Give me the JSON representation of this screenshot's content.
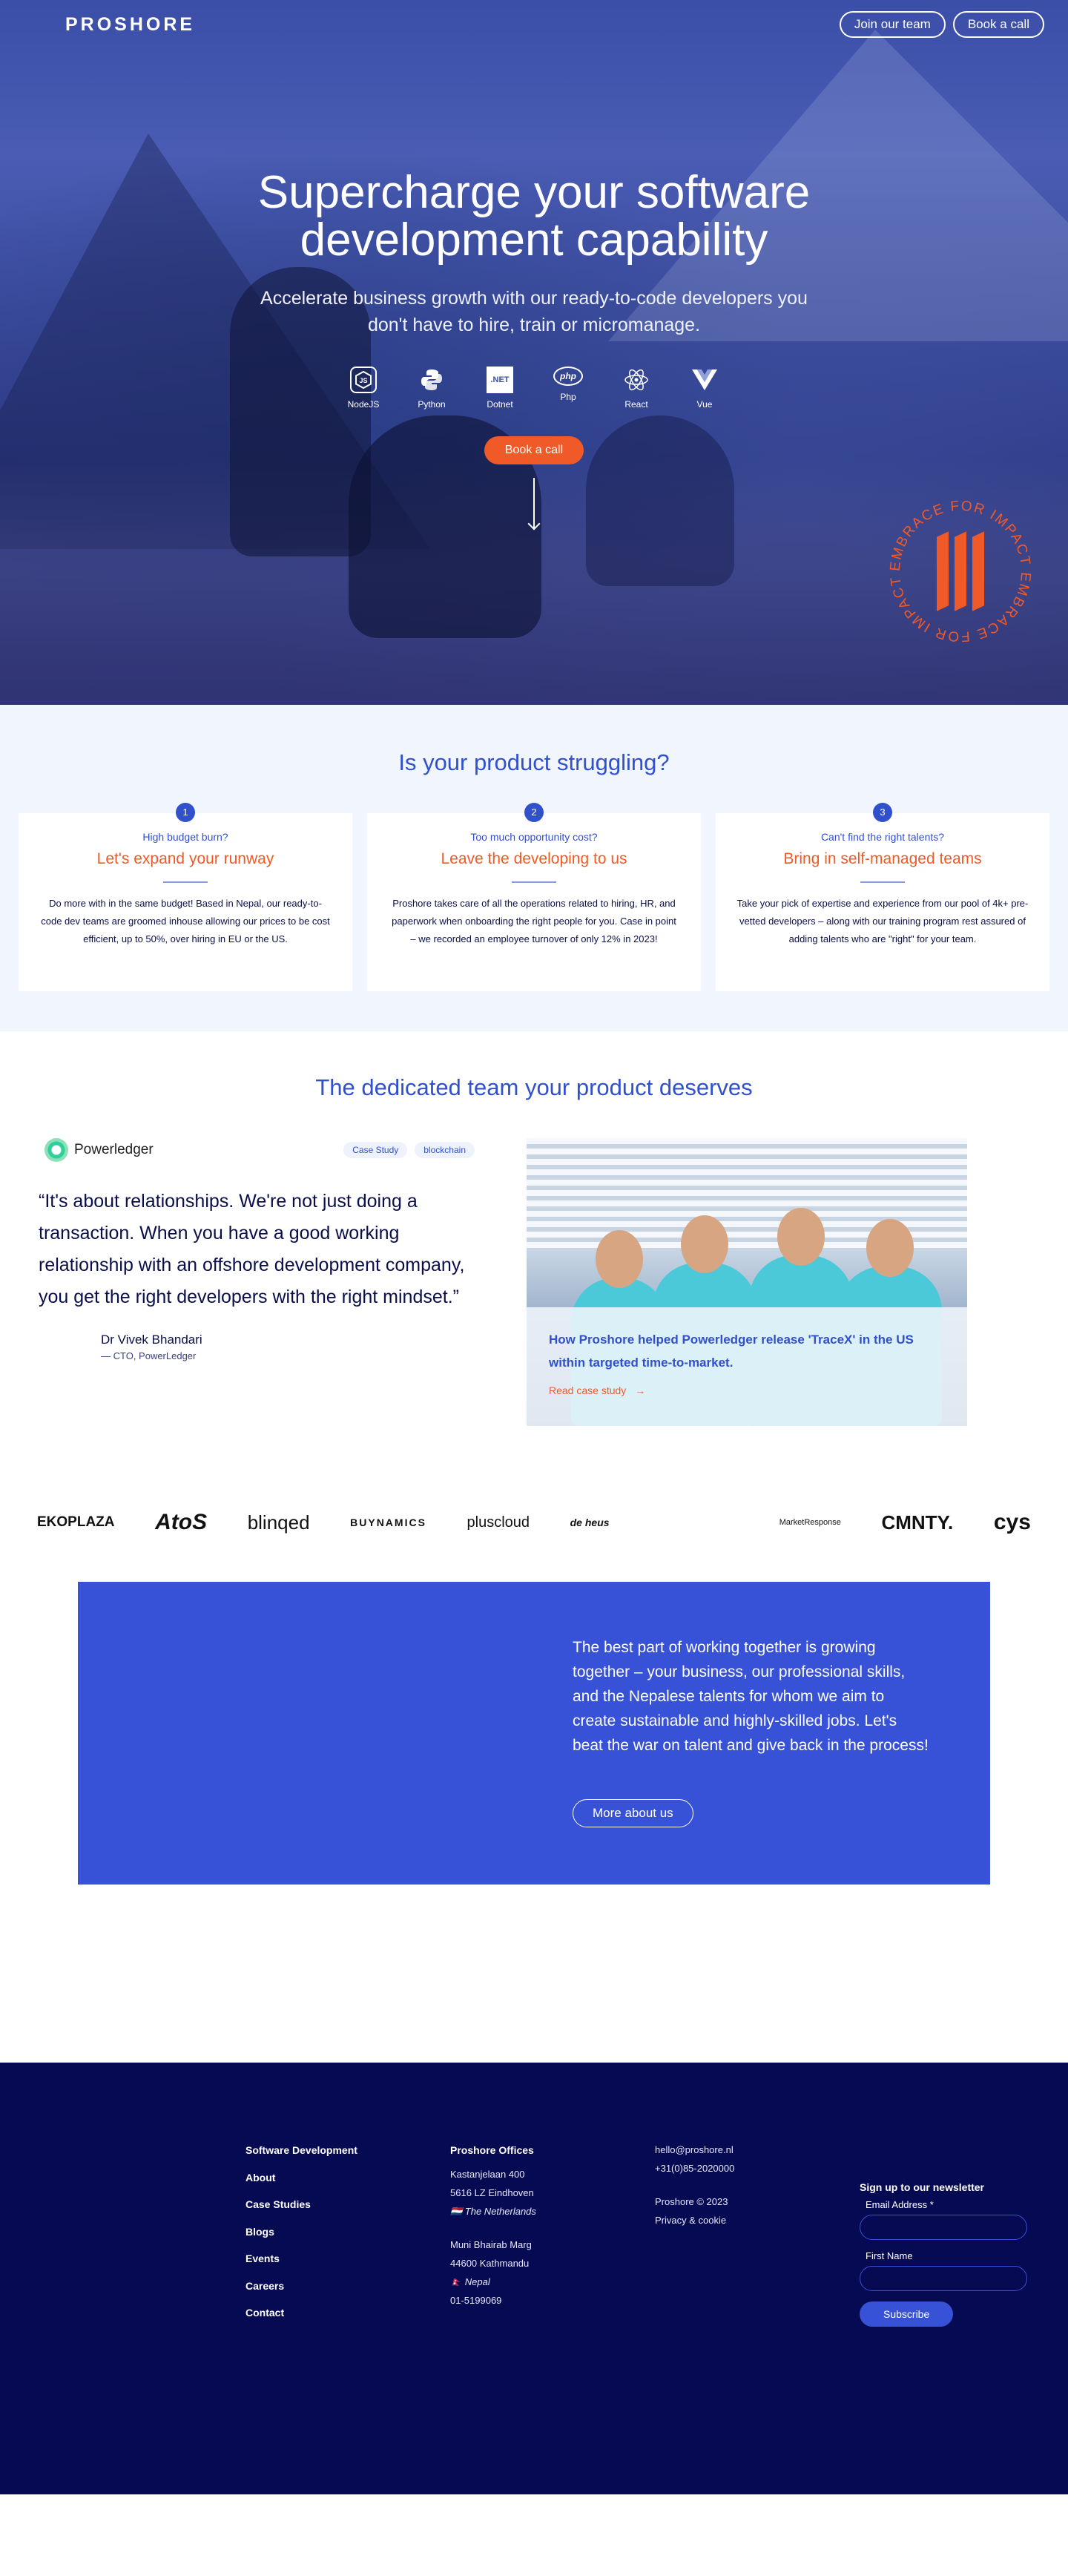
{
  "header": {
    "logo": "PROSHORE",
    "join_label": "Join our team",
    "book_label": "Book a call"
  },
  "hero": {
    "title": "Supercharge your software development capability",
    "subtitle": "Accelerate business growth with our ready-to-code developers you don't have to hire, train or micromanage.",
    "technologies": [
      {
        "label": "NodeJS",
        "icon": "nodejs-icon"
      },
      {
        "label": "Python",
        "icon": "python-icon"
      },
      {
        "label": "Dotnet",
        "icon": "dotnet-icon"
      },
      {
        "label": "Php",
        "icon": "php-icon"
      },
      {
        "label": "React",
        "icon": "react-icon"
      },
      {
        "label": "Vue",
        "icon": "vue-icon"
      }
    ],
    "dotnet_text": ".NET",
    "php_text": "php",
    "cta_label": "Book a call",
    "badge_text": "EMBRACE FOR IMPACT EMBRACE FOR IMPACT"
  },
  "struggle": {
    "title": "Is your product struggling?",
    "cards": [
      {
        "num": "1",
        "eyebrow": "High budget burn?",
        "title": "Let's expand your runway",
        "text": "Do more with in the same budget! Based in Nepal, our ready-to-code dev teams are groomed inhouse allowing our prices to be cost efficient, up to 50%, over hiring in EU or the US."
      },
      {
        "num": "2",
        "eyebrow": "Too much opportunity cost?",
        "title": "Leave the developing to us",
        "text": "Proshore takes care of all the operations related to hiring, HR, and paperwork when onboarding the right people for you. Case in point – we recorded an employee turnover of only 12% in 2023!"
      },
      {
        "num": "3",
        "eyebrow": "Can't find the right talents?",
        "title": "Bring in self-managed teams",
        "text": "Take your pick of expertise and experience from our pool of 4k+ pre-vetted developers – along with our training program rest assured of adding talents who are \"right\" for your team."
      }
    ]
  },
  "team": {
    "title": "The dedicated team your product deserves",
    "client_name": "Powerledger",
    "tags": [
      "Case Study",
      "blockchain"
    ],
    "quote": "“It's about relationships. We're not just doing a transaction. When you have a good working relationship with an offshore development company, you get the right developers with the right mindset.”",
    "author_name": "Dr Vivek Bhandari",
    "author_role": "— CTO, PowerLedger",
    "case_title": "How Proshore helped Powerledger release 'TraceX' in the US within targeted time-to-market.",
    "case_link": "Read case study",
    "case_arrow": "→"
  },
  "clients": [
    "EKOPLAZA",
    "AtoS",
    "blinqed",
    "BUYNAMICS",
    "pluscloud",
    "de heus",
    "MarketResponse",
    "CMNTY.",
    "cys"
  ],
  "about": {
    "text": "The best part of working together is growing together – your business, our professional skills, and the Nepalese talents for whom we aim to create sustainable and highly-skilled jobs. Let's beat the war on talent and give back in the process!",
    "button": "More about us"
  },
  "footer": {
    "nav": [
      "Software Development",
      "About",
      "Case Studies",
      "Blogs",
      "Events",
      "Careers",
      "Contact"
    ],
    "offices_title": "Proshore Offices",
    "nl_lines": [
      "Kastanjelaan 400",
      "5616 LZ Eindhoven",
      "🇳🇱 The Netherlands"
    ],
    "np_lines": [
      "Muni Bhairab Marg",
      "44600 Kathmandu",
      "🇳🇵 Nepal",
      "01-5199069"
    ],
    "email": "hello@proshore.nl",
    "phone": "+31(0)85-2020000",
    "copyright": "Proshore © 2023",
    "privacy": "Privacy & cookie",
    "newsletter_title": "Sign up to our newsletter",
    "email_label": "Email Address *",
    "first_name_label": "First Name",
    "subscribe_label": "Subscribe"
  },
  "colors": {
    "brand_blue": "#3050cc",
    "accent_orange": "#f05a28",
    "footer_navy": "#060a52"
  }
}
